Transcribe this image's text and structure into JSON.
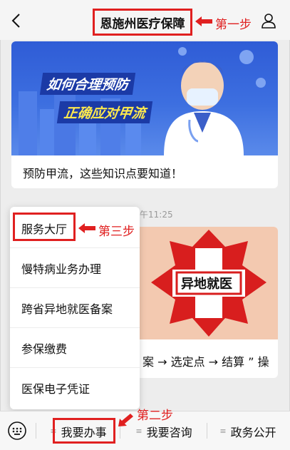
{
  "header": {
    "title": "恩施州医疗保障",
    "step1": "第一步"
  },
  "card1": {
    "banner_line1": "如何合理预防",
    "banner_line2": "正确应对甲流",
    "title": "预防甲流，这些知识点要知道！"
  },
  "timestamp": "午11:25",
  "card2": {
    "banner_sign": "异地就医",
    "text": "案 → 选定点 → 结算 ” 操"
  },
  "popup": {
    "step3": "第三步",
    "items": [
      {
        "label": "服务大厅"
      },
      {
        "label": "慢特病业务办理"
      },
      {
        "label": "跨省异地就医备案"
      },
      {
        "label": "参保缴费"
      },
      {
        "label": "医保电子凭证"
      }
    ]
  },
  "bottom": {
    "step2": "第二步",
    "menus": [
      {
        "label": "我要办事"
      },
      {
        "label": "我要咨询"
      },
      {
        "label": "政务公开"
      }
    ]
  },
  "colors": {
    "annotation_red": "#e02020",
    "banner_blue": "#2f5cd6"
  }
}
